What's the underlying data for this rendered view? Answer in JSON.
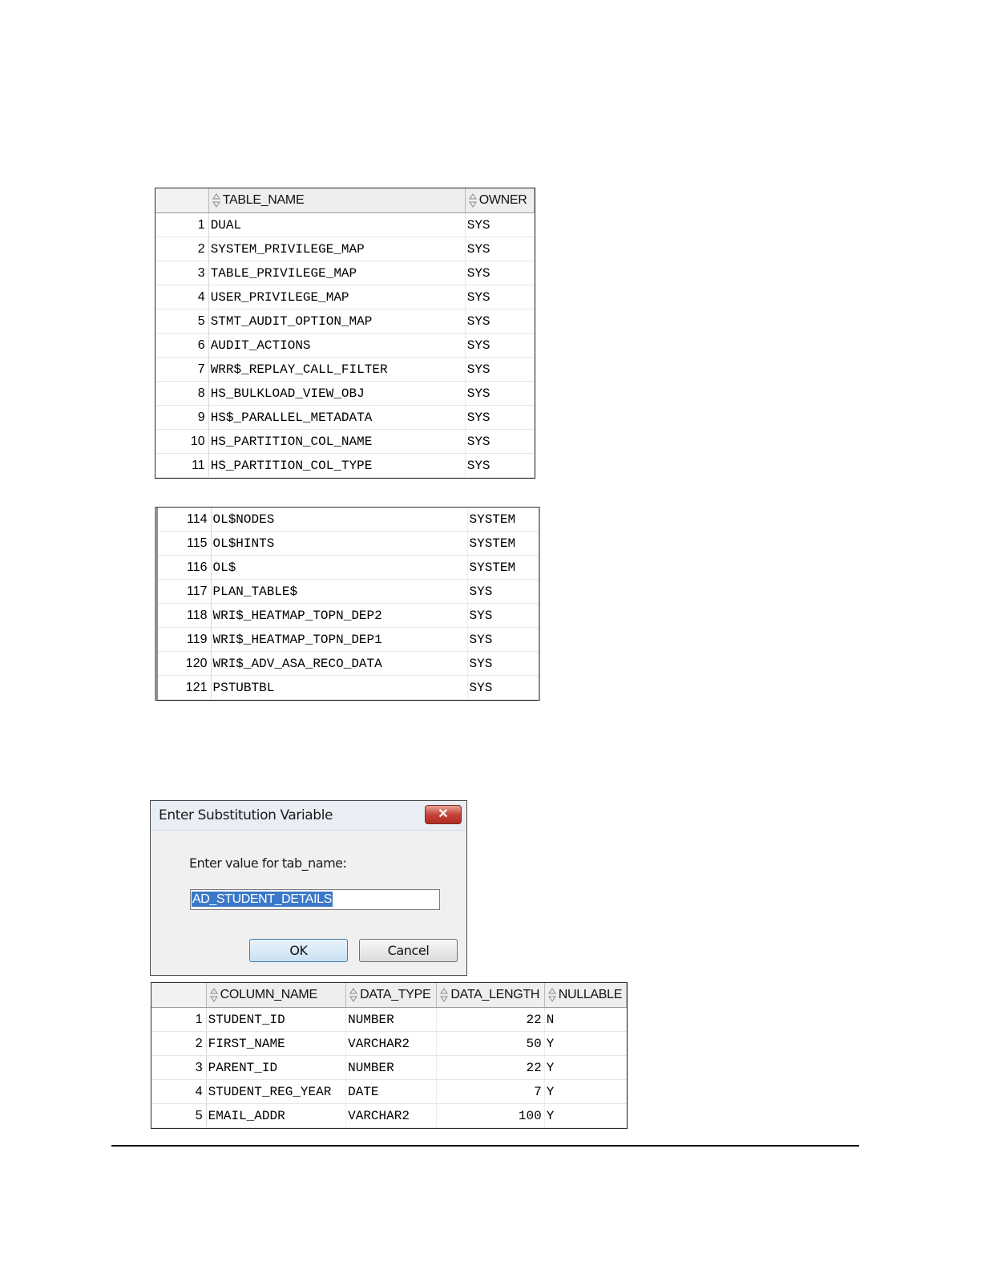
{
  "table1": {
    "headers": [
      "TABLE_NAME",
      "OWNER"
    ],
    "rows": [
      {
        "n": "1",
        "name": "DUAL",
        "owner": "SYS"
      },
      {
        "n": "2",
        "name": "SYSTEM_PRIVILEGE_MAP",
        "owner": "SYS"
      },
      {
        "n": "3",
        "name": "TABLE_PRIVILEGE_MAP",
        "owner": "SYS"
      },
      {
        "n": "4",
        "name": "USER_PRIVILEGE_MAP",
        "owner": "SYS"
      },
      {
        "n": "5",
        "name": "STMT_AUDIT_OPTION_MAP",
        "owner": "SYS"
      },
      {
        "n": "6",
        "name": "AUDIT_ACTIONS",
        "owner": "SYS"
      },
      {
        "n": "7",
        "name": "WRR$_REPLAY_CALL_FILTER",
        "owner": "SYS"
      },
      {
        "n": "8",
        "name": "HS_BULKLOAD_VIEW_OBJ",
        "owner": "SYS"
      },
      {
        "n": "9",
        "name": "HS$_PARALLEL_METADATA",
        "owner": "SYS"
      },
      {
        "n": "10",
        "name": "HS_PARTITION_COL_NAME",
        "owner": "SYS"
      },
      {
        "n": "11",
        "name": "HS_PARTITION_COL_TYPE",
        "owner": "SYS"
      }
    ]
  },
  "table2": {
    "rows": [
      {
        "n": "114",
        "name": "OL$NODES",
        "owner": "SYSTEM"
      },
      {
        "n": "115",
        "name": "OL$HINTS",
        "owner": "SYSTEM"
      },
      {
        "n": "116",
        "name": "OL$",
        "owner": "SYSTEM"
      },
      {
        "n": "117",
        "name": "PLAN_TABLE$",
        "owner": "SYS"
      },
      {
        "n": "118",
        "name": "WRI$_HEATMAP_TOPN_DEP2",
        "owner": "SYS"
      },
      {
        "n": "119",
        "name": "WRI$_HEATMAP_TOPN_DEP1",
        "owner": "SYS"
      },
      {
        "n": "120",
        "name": "WRI$_ADV_ASA_RECO_DATA",
        "owner": "SYS"
      },
      {
        "n": "121",
        "name": "PSTUBTBL",
        "owner": "SYS"
      }
    ]
  },
  "dialog": {
    "title": "Enter Substitution Variable",
    "close_symbol": "✕",
    "prompt": "Enter value for tab_name:",
    "input_value": "AD_STUDENT_DETAILS",
    "ok_label": "OK",
    "cancel_label": "Cancel"
  },
  "table3": {
    "headers": [
      "COLUMN_NAME",
      "DATA_TYPE",
      "DATA_LENGTH",
      "NULLABLE"
    ],
    "rows": [
      {
        "n": "1",
        "col": "STUDENT_ID",
        "type": "NUMBER",
        "len": "22",
        "nullable": "N"
      },
      {
        "n": "2",
        "col": "FIRST_NAME",
        "type": "VARCHAR2",
        "len": "50",
        "nullable": "Y"
      },
      {
        "n": "3",
        "col": "PARENT_ID",
        "type": "NUMBER",
        "len": "22",
        "nullable": "Y"
      },
      {
        "n": "4",
        "col": "STUDENT_REG_YEAR",
        "type": "DATE",
        "len": "7",
        "nullable": "Y"
      },
      {
        "n": "5",
        "col": "EMAIL_ADDR",
        "type": "VARCHAR2",
        "len": "100",
        "nullable": "Y"
      }
    ]
  }
}
